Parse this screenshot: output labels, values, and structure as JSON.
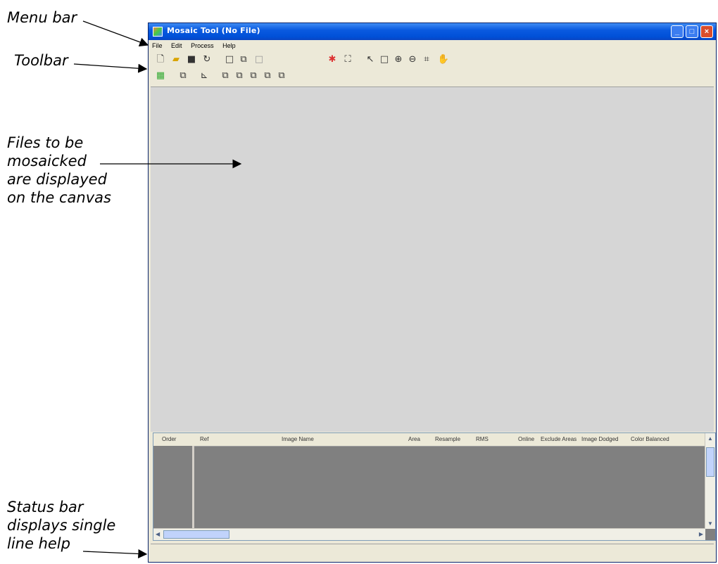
{
  "annotations": {
    "menu_bar": "Menu bar",
    "toolbar": "Toolbar",
    "canvas": [
      "Files to be",
      "mosaicked",
      "are displayed",
      "on the canvas"
    ],
    "status_bar": [
      "Status bar",
      "displays single",
      "line help"
    ]
  },
  "window": {
    "title": "Mosaic Tool (No File)",
    "controls": {
      "minimize": "_",
      "maximize": "□",
      "close": "×"
    }
  },
  "menu": [
    "File",
    "Edit",
    "Process",
    "Help"
  ],
  "toolbar_row1_icons": [
    "new-file-icon",
    "open-folder-icon",
    "save-icon",
    "save-as-icon",
    "rectangle-select-icon",
    "copy-icon",
    "blank-square-icon",
    "run-icon",
    "fit-icon",
    "pointer-icon",
    "select-box-icon",
    "zoom-in-icon",
    "zoom-out-icon",
    "crop-icon",
    "pan-hand-icon"
  ],
  "toolbar_row2_icons": [
    "grid-view-icon",
    "layer-icon",
    "chart-icon",
    "bring-to-top-icon",
    "bring-forward-icon",
    "send-backward-icon",
    "send-to-bottom-icon",
    "reverse-order-icon"
  ],
  "table": {
    "columns": [
      "Order",
      "Ref",
      "Image Name",
      "Area",
      "Resample",
      "RMS",
      "Online",
      "Exclude Areas",
      "Image Dodged",
      "Color Balanced"
    ]
  },
  "status_text": ""
}
